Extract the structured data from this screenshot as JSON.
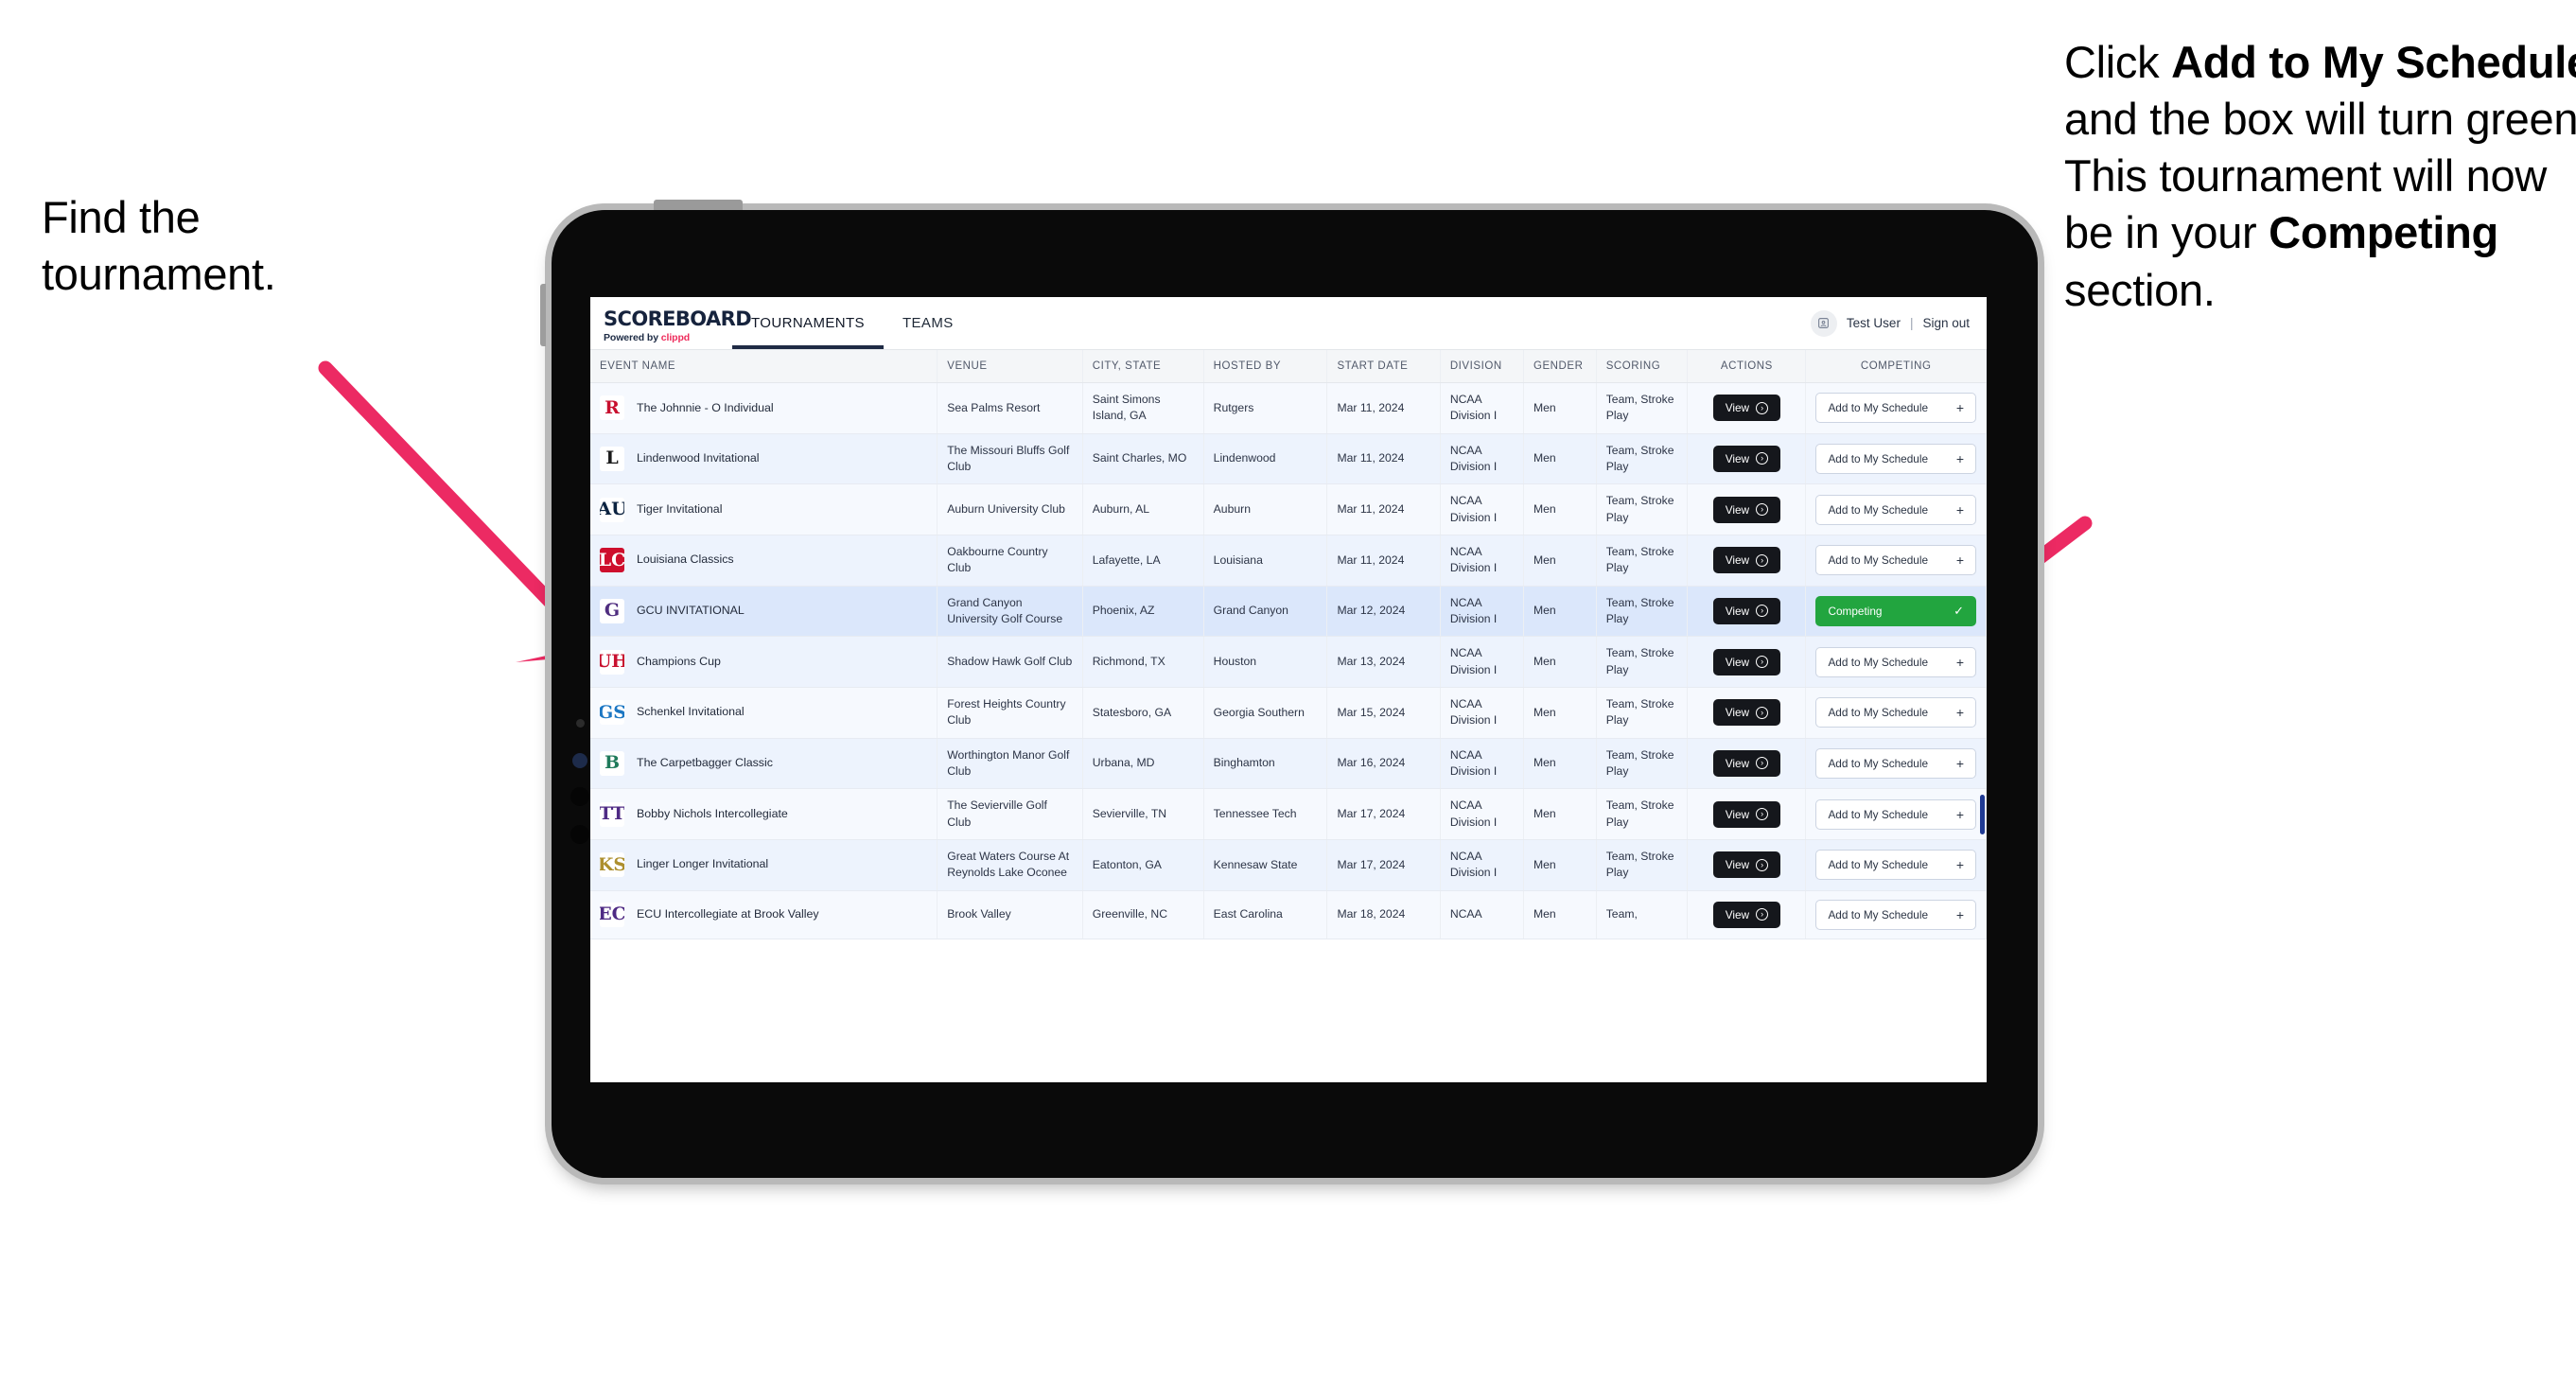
{
  "annotations": {
    "left": {
      "lines": [
        "Find the",
        "tournament."
      ]
    },
    "right": {
      "pre1": "Click ",
      "bold1": "Add to My Schedule",
      "mid1": " and the box will turn green. This tournament will now be in your ",
      "bold2": "Competing",
      "post": " section."
    },
    "arrow_color": "#ec2a63"
  },
  "app": {
    "brand": {
      "name": "SCOREBOARD",
      "powered_prefix": "Powered by ",
      "powered_brand": "clippd"
    },
    "nav": [
      {
        "label": "TOURNAMENTS",
        "active": true
      },
      {
        "label": "TEAMS",
        "active": false
      }
    ],
    "account": {
      "avatar_icon": "user-badge-icon",
      "user": "Test User",
      "separator": "|",
      "signout": "Sign out"
    },
    "table": {
      "columns": [
        "EVENT NAME",
        "VENUE",
        "CITY, STATE",
        "HOSTED BY",
        "START DATE",
        "DIVISION",
        "GENDER",
        "SCORING",
        "ACTIONS",
        "COMPETING"
      ],
      "action_label": "View",
      "add_label": "Add to My Schedule",
      "add_icon": "plus-icon",
      "competing_label": "Competing",
      "competing_icon": "check-icon",
      "competing_color": "#22a53f",
      "rows": [
        {
          "logo_text": "R",
          "logo_bg": "#ffffff",
          "logo_fg": "#c8102e",
          "event": "The Johnnie - O Individual",
          "venue": "Sea Palms Resort",
          "city": "Saint Simons Island, GA",
          "host": "Rutgers",
          "date": "Mar 11, 2024",
          "division": "NCAA Division I",
          "gender": "Men",
          "scoring": "Team, Stroke Play",
          "competing": false
        },
        {
          "logo_text": "L",
          "logo_bg": "#ffffff",
          "logo_fg": "#1a1a1a",
          "event": "Lindenwood Invitational",
          "venue": "The Missouri Bluffs Golf Club",
          "city": "Saint Charles, MO",
          "host": "Lindenwood",
          "date": "Mar 11, 2024",
          "division": "NCAA Division I",
          "gender": "Men",
          "scoring": "Team, Stroke Play",
          "competing": false
        },
        {
          "logo_text": "AU",
          "logo_bg": "#ffffff",
          "logo_fg": "#0c2340",
          "event": "Tiger Invitational",
          "venue": "Auburn University Club",
          "city": "Auburn, AL",
          "host": "Auburn",
          "date": "Mar 11, 2024",
          "division": "NCAA Division I",
          "gender": "Men",
          "scoring": "Team, Stroke Play",
          "competing": false
        },
        {
          "logo_text": "LC",
          "logo_bg": "#ce0e2d",
          "logo_fg": "#ffffff",
          "event": "Louisiana Classics",
          "venue": "Oakbourne Country Club",
          "city": "Lafayette, LA",
          "host": "Louisiana",
          "date": "Mar 11, 2024",
          "division": "NCAA Division I",
          "gender": "Men",
          "scoring": "Team, Stroke Play",
          "competing": false
        },
        {
          "logo_text": "G",
          "logo_bg": "#ffffff",
          "logo_fg": "#4f2d7f",
          "event": "GCU INVITATIONAL",
          "venue": "Grand Canyon University Golf Course",
          "city": "Phoenix, AZ",
          "host": "Grand Canyon",
          "date": "Mar 12, 2024",
          "division": "NCAA Division I",
          "gender": "Men",
          "scoring": "Team, Stroke Play",
          "competing": true
        },
        {
          "logo_text": "UH",
          "logo_bg": "#ffffff",
          "logo_fg": "#c8102e",
          "event": "Champions Cup",
          "venue": "Shadow Hawk Golf Club",
          "city": "Richmond, TX",
          "host": "Houston",
          "date": "Mar 13, 2024",
          "division": "NCAA Division I",
          "gender": "Men",
          "scoring": "Team, Stroke Play",
          "competing": false
        },
        {
          "logo_text": "GS",
          "logo_bg": "#ffffff",
          "logo_fg": "#1c77c3",
          "event": "Schenkel Invitational",
          "venue": "Forest Heights Country Club",
          "city": "Statesboro, GA",
          "host": "Georgia Southern",
          "date": "Mar 15, 2024",
          "division": "NCAA Division I",
          "gender": "Men",
          "scoring": "Team, Stroke Play",
          "competing": false
        },
        {
          "logo_text": "B",
          "logo_bg": "#ffffff",
          "logo_fg": "#1f7a5a",
          "event": "The Carpetbagger Classic",
          "venue": "Worthington Manor Golf Club",
          "city": "Urbana, MD",
          "host": "Binghamton",
          "date": "Mar 16, 2024",
          "division": "NCAA Division I",
          "gender": "Men",
          "scoring": "Team, Stroke Play",
          "competing": false
        },
        {
          "logo_text": "TT",
          "logo_bg": "#ffffff",
          "logo_fg": "#4e2a84",
          "event": "Bobby Nichols Intercollegiate",
          "venue": "The Sevierville Golf Club",
          "city": "Sevierville, TN",
          "host": "Tennessee Tech",
          "date": "Mar 17, 2024",
          "division": "NCAA Division I",
          "gender": "Men",
          "scoring": "Team, Stroke Play",
          "competing": false
        },
        {
          "logo_text": "KS",
          "logo_bg": "#ffffff",
          "logo_fg": "#ad8f2e",
          "event": "Linger Longer Invitational",
          "venue": "Great Waters Course At Reynolds Lake Oconee",
          "city": "Eatonton, GA",
          "host": "Kennesaw State",
          "date": "Mar 17, 2024",
          "division": "NCAA Division I",
          "gender": "Men",
          "scoring": "Team, Stroke Play",
          "competing": false
        },
        {
          "logo_text": "EC",
          "logo_bg": "#ffffff",
          "logo_fg": "#4e2a84",
          "event": "ECU Intercollegiate at Brook Valley",
          "venue": "Brook Valley",
          "city": "Greenville, NC",
          "host": "East Carolina",
          "date": "Mar 18, 2024",
          "division": "NCAA",
          "gender": "Men",
          "scoring": "Team,",
          "competing": false
        }
      ]
    }
  }
}
